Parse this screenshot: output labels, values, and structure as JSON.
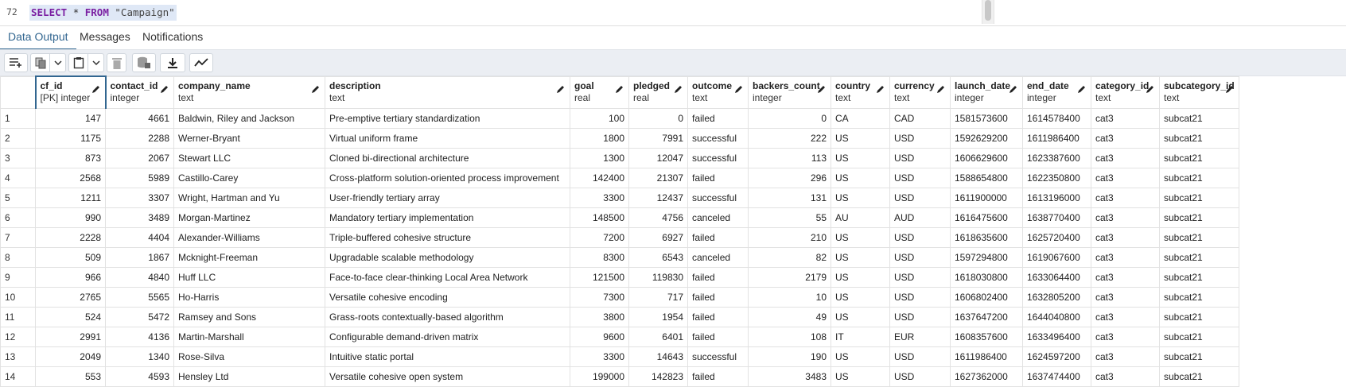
{
  "editor": {
    "line_number": "72",
    "query": {
      "kw1": "SELECT",
      "star": "*",
      "kw2": "FROM",
      "table": "\"Campaign\""
    }
  },
  "tabs": [
    {
      "label": "Data Output"
    },
    {
      "label": "Messages"
    },
    {
      "label": "Notifications"
    }
  ],
  "colors": {
    "accent": "#326690",
    "keyword": "#7a1fa2",
    "selection": "#dfe8f6"
  },
  "toolbar": {
    "icons": [
      "add-row-icon",
      "copy-icon",
      "copy-dropdown-icon",
      "paste-icon",
      "paste-dropdown-icon",
      "delete-icon",
      "save-data-icon",
      "download-icon",
      "graph-icon"
    ]
  },
  "grid": {
    "columns": [
      {
        "name": "cf_id",
        "type": "[PK] integer"
      },
      {
        "name": "contact_id",
        "type": "integer"
      },
      {
        "name": "company_name",
        "type": "text"
      },
      {
        "name": "description",
        "type": "text"
      },
      {
        "name": "goal",
        "type": "real"
      },
      {
        "name": "pledged",
        "type": "real"
      },
      {
        "name": "outcome",
        "type": "text"
      },
      {
        "name": "backers_count",
        "type": "integer"
      },
      {
        "name": "country",
        "type": "text"
      },
      {
        "name": "currency",
        "type": "text"
      },
      {
        "name": "launch_date",
        "type": "integer"
      },
      {
        "name": "end_date",
        "type": "integer"
      },
      {
        "name": "category_id",
        "type": "text"
      },
      {
        "name": "subcategory_id",
        "type": "text"
      }
    ],
    "rows": [
      [
        "1",
        "147",
        "4661",
        "Baldwin, Riley and Jackson",
        "Pre-emptive tertiary standardization",
        "100",
        "0",
        "failed",
        "0",
        "CA",
        "CAD",
        "1581573600",
        "1614578400",
        "cat3",
        "subcat21"
      ],
      [
        "2",
        "1175",
        "2288",
        "Werner-Bryant",
        "Virtual uniform frame",
        "1800",
        "7991",
        "successful",
        "222",
        "US",
        "USD",
        "1592629200",
        "1611986400",
        "cat3",
        "subcat21"
      ],
      [
        "3",
        "873",
        "2067",
        "Stewart LLC",
        "Cloned bi-directional architecture",
        "1300",
        "12047",
        "successful",
        "113",
        "US",
        "USD",
        "1606629600",
        "1623387600",
        "cat3",
        "subcat21"
      ],
      [
        "4",
        "2568",
        "5989",
        "Castillo-Carey",
        "Cross-platform solution-oriented process improvement",
        "142400",
        "21307",
        "failed",
        "296",
        "US",
        "USD",
        "1588654800",
        "1622350800",
        "cat3",
        "subcat21"
      ],
      [
        "5",
        "1211",
        "3307",
        "Wright, Hartman and Yu",
        "User-friendly tertiary array",
        "3300",
        "12437",
        "successful",
        "131",
        "US",
        "USD",
        "1611900000",
        "1613196000",
        "cat3",
        "subcat21"
      ],
      [
        "6",
        "990",
        "3489",
        "Morgan-Martinez",
        "Mandatory tertiary implementation",
        "148500",
        "4756",
        "canceled",
        "55",
        "AU",
        "AUD",
        "1616475600",
        "1638770400",
        "cat3",
        "subcat21"
      ],
      [
        "7",
        "2228",
        "4404",
        "Alexander-Williams",
        "Triple-buffered cohesive structure",
        "7200",
        "6927",
        "failed",
        "210",
        "US",
        "USD",
        "1618635600",
        "1625720400",
        "cat3",
        "subcat21"
      ],
      [
        "8",
        "509",
        "1867",
        "Mcknight-Freeman",
        "Upgradable scalable methodology",
        "8300",
        "6543",
        "canceled",
        "82",
        "US",
        "USD",
        "1597294800",
        "1619067600",
        "cat3",
        "subcat21"
      ],
      [
        "9",
        "966",
        "4840",
        "Huff LLC",
        "Face-to-face clear-thinking Local Area Network",
        "121500",
        "119830",
        "failed",
        "2179",
        "US",
        "USD",
        "1618030800",
        "1633064400",
        "cat3",
        "subcat21"
      ],
      [
        "10",
        "2765",
        "5565",
        "Ho-Harris",
        "Versatile cohesive encoding",
        "7300",
        "717",
        "failed",
        "10",
        "US",
        "USD",
        "1606802400",
        "1632805200",
        "cat3",
        "subcat21"
      ],
      [
        "11",
        "524",
        "5472",
        "Ramsey and Sons",
        "Grass-roots contextually-based algorithm",
        "3800",
        "1954",
        "failed",
        "49",
        "US",
        "USD",
        "1637647200",
        "1644040800",
        "cat3",
        "subcat21"
      ],
      [
        "12",
        "2991",
        "4136",
        "Martin-Marshall",
        "Configurable demand-driven matrix",
        "9600",
        "6401",
        "failed",
        "108",
        "IT",
        "EUR",
        "1608357600",
        "1633496400",
        "cat3",
        "subcat21"
      ],
      [
        "13",
        "2049",
        "1340",
        "Rose-Silva",
        "Intuitive static portal",
        "3300",
        "14643",
        "successful",
        "190",
        "US",
        "USD",
        "1611986400",
        "1624597200",
        "cat3",
        "subcat21"
      ],
      [
        "14",
        "553",
        "4593",
        "Hensley Ltd",
        "Versatile cohesive open system",
        "199000",
        "142823",
        "failed",
        "3483",
        "US",
        "USD",
        "1627362000",
        "1637474400",
        "cat3",
        "subcat21"
      ]
    ]
  }
}
